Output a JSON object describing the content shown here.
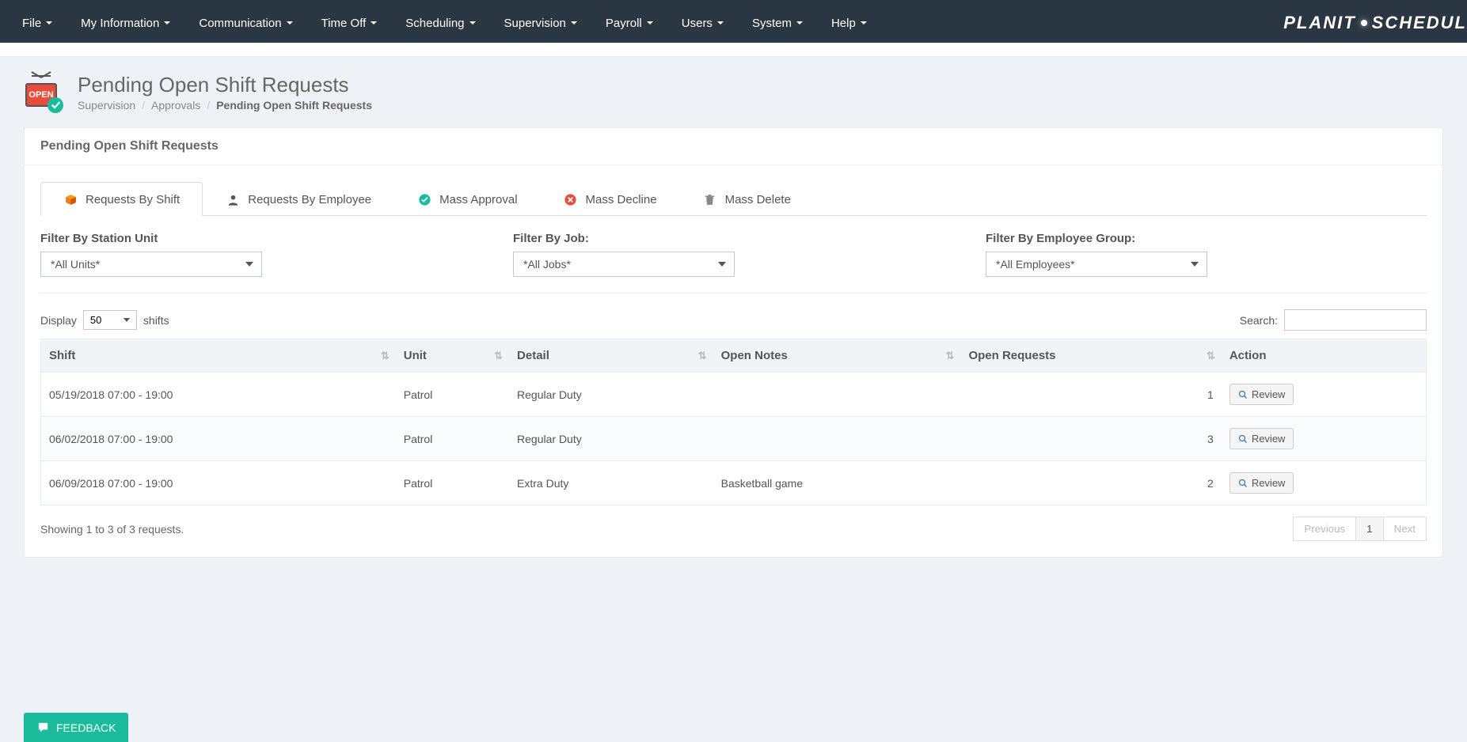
{
  "nav": {
    "items": [
      {
        "label": "File"
      },
      {
        "label": "My Information"
      },
      {
        "label": "Communication"
      },
      {
        "label": "Time Off"
      },
      {
        "label": "Scheduling"
      },
      {
        "label": "Supervision"
      },
      {
        "label": "Payroll"
      },
      {
        "label": "Users"
      },
      {
        "label": "System"
      },
      {
        "label": "Help"
      }
    ],
    "brand_part1": "PLANIT",
    "brand_part2": "SCHEDUL"
  },
  "page": {
    "title": "Pending Open Shift Requests",
    "icon_text": "OPEN",
    "breadcrumb": [
      {
        "label": "Supervision"
      },
      {
        "label": "Approvals"
      },
      {
        "label": "Pending Open Shift Requests",
        "active": true
      }
    ]
  },
  "panel": {
    "title": "Pending Open Shift Requests"
  },
  "tabs": [
    {
      "label": "Requests By Shift",
      "icon": "box",
      "active": true
    },
    {
      "label": "Requests By Employee",
      "icon": "person"
    },
    {
      "label": "Mass Approval",
      "icon": "check-circle"
    },
    {
      "label": "Mass Decline",
      "icon": "x-circle"
    },
    {
      "label": "Mass Delete",
      "icon": "trash"
    }
  ],
  "filters": {
    "unit": {
      "label": "Filter By Station Unit",
      "value": "*All Units*"
    },
    "job": {
      "label": "Filter By Job:",
      "value": "*All Jobs*"
    },
    "group": {
      "label": "Filter By Employee Group:",
      "value": "*All Employees*"
    }
  },
  "table": {
    "display_label_before": "Display",
    "display_value": "50",
    "display_label_after": "shifts",
    "search_label": "Search:",
    "search_value": "",
    "columns": [
      "Shift",
      "Unit",
      "Detail",
      "Open Notes",
      "Open Requests",
      "Action"
    ],
    "rows": [
      {
        "shift": "05/19/2018 07:00 - 19:00",
        "unit": "Patrol",
        "detail": "Regular Duty",
        "notes": "",
        "requests": "1"
      },
      {
        "shift": "06/02/2018 07:00 - 19:00",
        "unit": "Patrol",
        "detail": "Regular Duty",
        "notes": "",
        "requests": "3"
      },
      {
        "shift": "06/09/2018 07:00 - 19:00",
        "unit": "Patrol",
        "detail": "Extra Duty",
        "notes": "Basketball game",
        "requests": "2"
      }
    ],
    "action_label": "Review",
    "info": "Showing 1 to 3 of 3 requests.",
    "pagination": {
      "previous": "Previous",
      "page": "1",
      "next": "Next"
    }
  },
  "feedback": {
    "label": "FEEDBACK"
  }
}
